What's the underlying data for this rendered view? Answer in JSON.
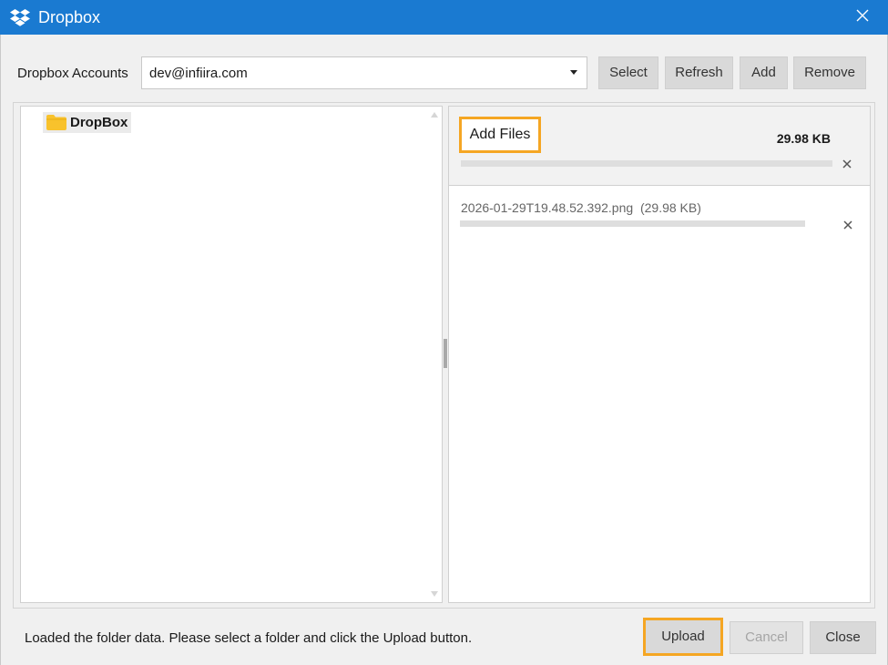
{
  "window": {
    "title": "Dropbox",
    "accent": "#1a7ad1",
    "highlight": "#f5a623"
  },
  "accounts": {
    "label": "Dropbox Accounts",
    "selected": "dev@infiira.com",
    "buttons": {
      "select": "Select",
      "refresh": "Refresh",
      "add": "Add",
      "remove": "Remove"
    }
  },
  "tree": {
    "items": [
      {
        "label": "DropBox",
        "icon": "folder-icon"
      }
    ]
  },
  "files": {
    "add_files_label": "Add Files",
    "total_size": "29.98 KB",
    "items": [
      {
        "name": "2026-01-29T19.48.52.392.png",
        "size": "(29.98 KB)"
      }
    ]
  },
  "footer": {
    "status": "Loaded the folder data. Please select a folder and click the Upload button.",
    "buttons": {
      "upload": "Upload",
      "cancel": "Cancel",
      "close": "Close"
    }
  }
}
